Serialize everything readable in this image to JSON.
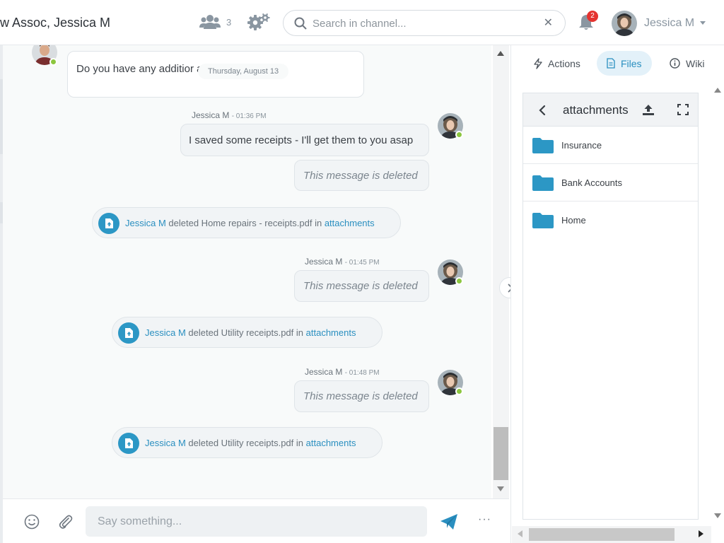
{
  "header": {
    "title": "w Assoc, Jessica M",
    "members_count": "3",
    "search_placeholder": "Search in channel...",
    "notification_count": "2",
    "user_name": "Jessica M"
  },
  "chat": {
    "date_divider": "Thursday, August 13",
    "first_message": {
      "text": "Do you have any additior ates to send me?"
    },
    "messages": [
      {
        "author": "Jessica M",
        "time": "01:36 PM",
        "text": "I saved some receipts - I'll get them to you asap",
        "deleted_text": "This message is deleted"
      },
      {
        "author": "Jessica M",
        "time": "01:45 PM",
        "deleted_text": "This message is deleted"
      },
      {
        "author": "Jessica M",
        "time": "01:48 PM",
        "deleted_text": "This message is deleted"
      }
    ],
    "system": [
      {
        "user": "Jessica M",
        "action": "deleted Home repairs - receipts.pdf in",
        "target": "attachments"
      },
      {
        "user": "Jessica M",
        "action": "deleted Utility receipts.pdf in",
        "target": "attachments"
      },
      {
        "user": "Jessica M",
        "action": "deleted Utility receipts.pdf in",
        "target": "attachments"
      }
    ]
  },
  "composer": {
    "placeholder": "Say something...",
    "more": "···"
  },
  "panel": {
    "tabs": [
      {
        "label": "Actions"
      },
      {
        "label": "Files"
      },
      {
        "label": "Wiki"
      }
    ],
    "active_tab": "Files",
    "folder_title": "attachments",
    "folders": [
      {
        "name": "Insurance"
      },
      {
        "name": "Bank Accounts"
      },
      {
        "name": "Home"
      }
    ]
  },
  "colors": {
    "accent": "#2a8fc0",
    "online": "#8cc63f",
    "badge": "#e4332f",
    "folder": "#2c97c5"
  }
}
